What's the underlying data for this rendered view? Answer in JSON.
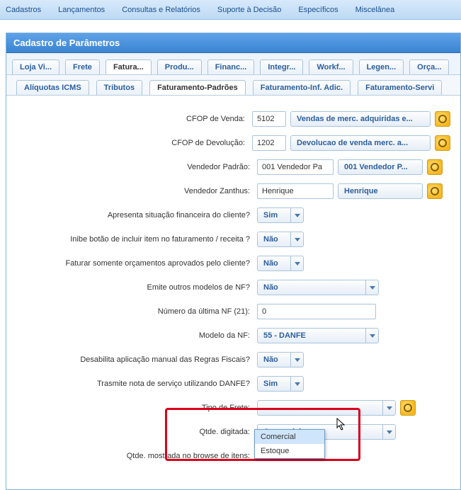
{
  "menubar": {
    "items": [
      "Cadastros",
      "Lançamentos",
      "Consultas e Relatórios",
      "Suporte à  Decisão",
      "Específicos",
      "Miscelânea"
    ]
  },
  "panel": {
    "title": "Cadastro de Parâmetros"
  },
  "tabs": {
    "main": [
      "Loja Vi...",
      "Frete",
      "Fatura...",
      "Produ...",
      "Financ...",
      "Integr...",
      "Workf...",
      "Legen...",
      "Orça..."
    ],
    "main_active_index": 2,
    "sub": [
      "Alíquotas ICMS",
      "Tributos",
      "Faturamento-Padrões",
      "Faturamento-Inf. Adic.",
      "Faturamento-Servi"
    ],
    "sub_active_index": 2
  },
  "form": {
    "cfop_venda": {
      "label": "CFOP de Venda:",
      "value": "5102",
      "desc": "Vendas de merc. adquiridas e..."
    },
    "cfop_devolucao": {
      "label": "CFOP de Devolução:",
      "value": "1202",
      "desc": "Devolucao de venda  merc. a..."
    },
    "vendedor_padrao": {
      "label": "Vendedor Padrão:",
      "value": "001 Vendedor Pa",
      "desc": "001 Vendedor P..."
    },
    "vendedor_zanthus": {
      "label": "Vendedor Zanthus:",
      "value": "Henrique",
      "desc": "Henrique"
    },
    "apresenta_fin": {
      "label": "Apresenta situação financeira do cliente?",
      "value": "Sim"
    },
    "inibe_incluir": {
      "label": "Inibe botão de incluir item no faturamento / receita ?",
      "value": "Não"
    },
    "faturar_orc": {
      "label": "Faturar somente orçamentos aprovados pelo cliente?",
      "value": "Não"
    },
    "emite_outros": {
      "label": "Emite outros modelos de NF?",
      "value": "Não"
    },
    "num_ultima_nf": {
      "label": "Número da última NF (21):",
      "value": "0"
    },
    "modelo_nf": {
      "label": "Modelo da NF:",
      "value": "55 - DANFE"
    },
    "desab_regras": {
      "label": "Desabilita aplicação manual das Regras Fiscais?",
      "value": "Não"
    },
    "transmite_danfe": {
      "label": "Trasmite nota de serviço utilizando DANFE?",
      "value": "Sim"
    },
    "tipo_frete": {
      "label": "Tipo de Frete:",
      "value": ""
    },
    "qtde_digitada": {
      "label": "Qtde. digitada:",
      "value": "Comercial",
      "options": [
        "Comercial",
        "Estoque"
      ],
      "selected_option_index": 0
    },
    "qtde_browse": {
      "label": "Qtde. mostrada no browse de itens:"
    }
  }
}
